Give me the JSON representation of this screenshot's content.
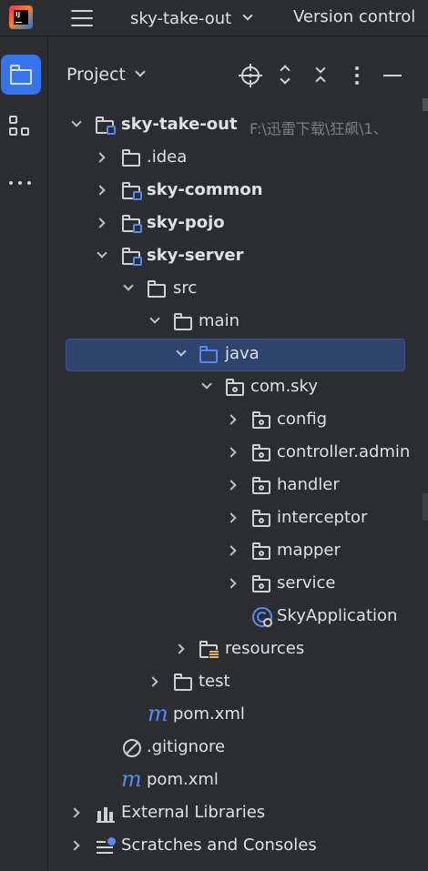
{
  "titlebar": {
    "logo_text": "IJ",
    "project_name": "sky-take-out",
    "vcs_label": "Version control"
  },
  "panel": {
    "title": "Project"
  },
  "tree": {
    "root_label": "sky-take-out",
    "root_path": "F:\\迅雷下载\\狂飙\\1、",
    "items": [
      {
        "label": "sky-take-out"
      },
      {
        "label": ".idea"
      },
      {
        "label": "sky-common"
      },
      {
        "label": "sky-pojo"
      },
      {
        "label": "sky-server"
      },
      {
        "label": "src"
      },
      {
        "label": "main"
      },
      {
        "label": "java"
      },
      {
        "label": "com.sky"
      },
      {
        "label": "config"
      },
      {
        "label": "controller.admin"
      },
      {
        "label": "handler"
      },
      {
        "label": "interceptor"
      },
      {
        "label": "mapper"
      },
      {
        "label": "service"
      },
      {
        "label": "SkyApplication"
      },
      {
        "label": "resources"
      },
      {
        "label": "test"
      },
      {
        "label": "pom.xml"
      },
      {
        "label": ".gitignore"
      },
      {
        "label": "pom.xml"
      },
      {
        "label": "External Libraries"
      },
      {
        "label": "Scratches and Consoles"
      }
    ]
  },
  "icons": {
    "maven_glyph": "m"
  },
  "colors": {
    "background": "#2b2d30",
    "accent": "#3574f0",
    "selection": "#2e436e",
    "module_blue": "#548af7"
  }
}
